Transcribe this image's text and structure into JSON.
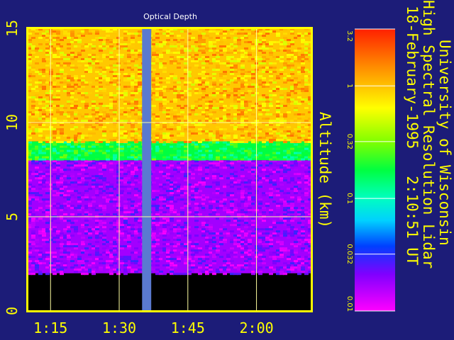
{
  "chart_data": {
    "type": "heatmap",
    "title": "Optical Depth",
    "ylabel": "Altitude (km)",
    "ylim": [
      0,
      15
    ],
    "yticks": [
      0,
      5,
      10,
      15
    ],
    "xlim": [
      "1:10",
      "2:12"
    ],
    "xticks": [
      "1:15",
      "1:30",
      "1:45",
      "2:00"
    ],
    "info_lines": [
      "University of Wisconsin",
      "High Spectral Resolution Lidar",
      "18-February-1995   2:10:51 UT"
    ],
    "colorbar": {
      "scale": "log",
      "range": [
        0.01,
        3.2
      ],
      "tick_labels": [
        "3.2",
        "1",
        "0.32",
        "0.1",
        "0.032",
        "0.01"
      ]
    },
    "data_gap": {
      "start": "1:35",
      "end": "1:37"
    },
    "layers": [
      {
        "name": "surface no-signal",
        "altitude_range": [
          0,
          2
        ],
        "level": "none"
      },
      {
        "name": "low optical depth",
        "altitude_range": [
          2,
          8
        ],
        "value_range": [
          0.01,
          0.03
        ]
      },
      {
        "name": "transition",
        "altitude_range": [
          8,
          9
        ],
        "value_range": [
          0.1,
          0.32
        ]
      },
      {
        "name": "cloud",
        "altitude_range": [
          9,
          15
        ],
        "value_range": [
          0.5,
          1.8
        ]
      }
    ],
    "colors": {
      "background": "#1c1c78",
      "frame": "#ffff00",
      "text": "#ffff00",
      "title": "#ffffff",
      "gap": "#5a7ad0",
      "grid": "#ffffa0"
    }
  }
}
